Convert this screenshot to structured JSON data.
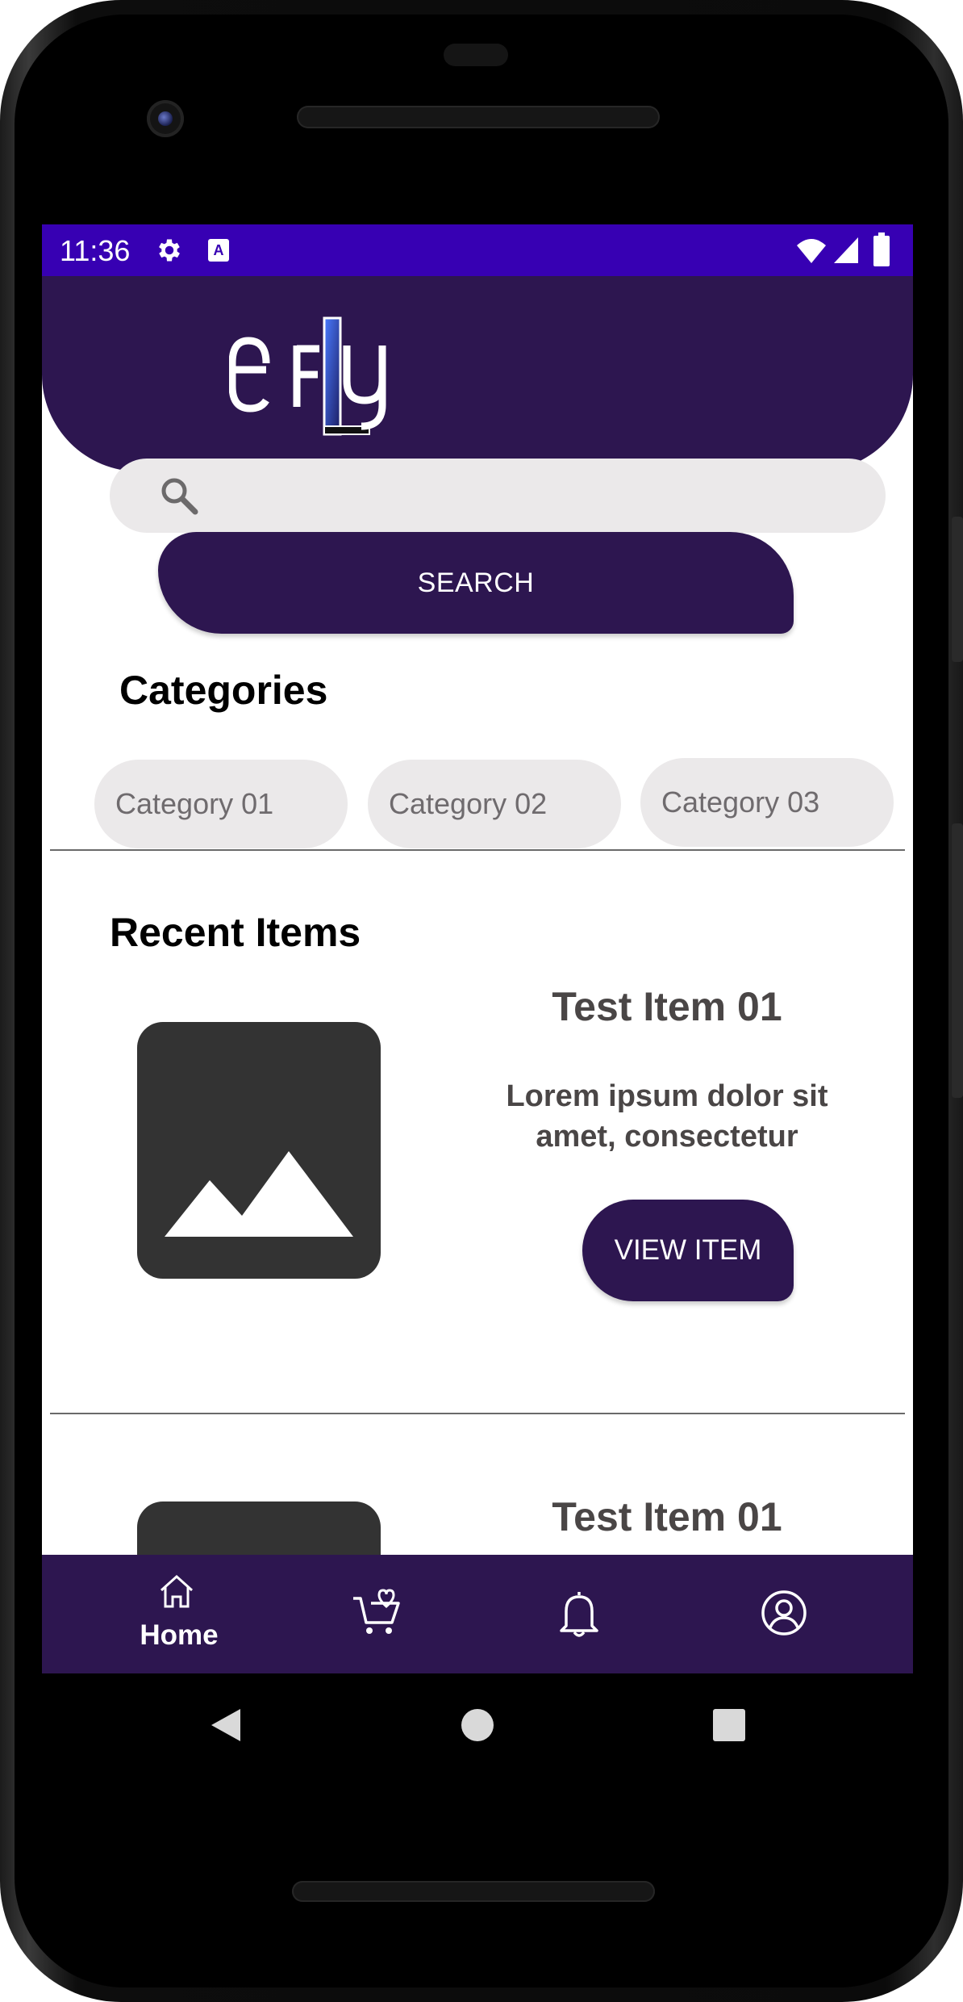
{
  "status_bar": {
    "time": "11:36",
    "icons": [
      "settings-icon",
      "font-icon",
      "wifi-icon",
      "signal-icon",
      "battery-icon"
    ],
    "color": "#3700b3"
  },
  "header": {
    "logo_text": "eFLY",
    "background": "#2d1650"
  },
  "search": {
    "placeholder": "",
    "button_label": "SEARCH"
  },
  "categories": {
    "title": "Categories",
    "items": [
      "Category 01",
      "Category 02",
      "Category 03"
    ]
  },
  "recent_items": {
    "title": "Recent Items",
    "items": [
      {
        "title": "Test Item 01",
        "description_line1": "Lorem ipsum dolor sit",
        "description_line2": "amet, consectetur",
        "button_label": "VIEW ITEM"
      },
      {
        "title": "Test Item 01"
      }
    ]
  },
  "bottom_nav": {
    "items": [
      {
        "label": "Home",
        "icon": "home-icon",
        "active": true
      },
      {
        "label": "",
        "icon": "cart-icon",
        "active": false
      },
      {
        "label": "",
        "icon": "bell-icon",
        "active": false
      },
      {
        "label": "",
        "icon": "account-icon",
        "active": false
      }
    ]
  },
  "system_nav": {
    "icons": [
      "back-icon",
      "home-circle-icon",
      "recents-icon"
    ]
  }
}
